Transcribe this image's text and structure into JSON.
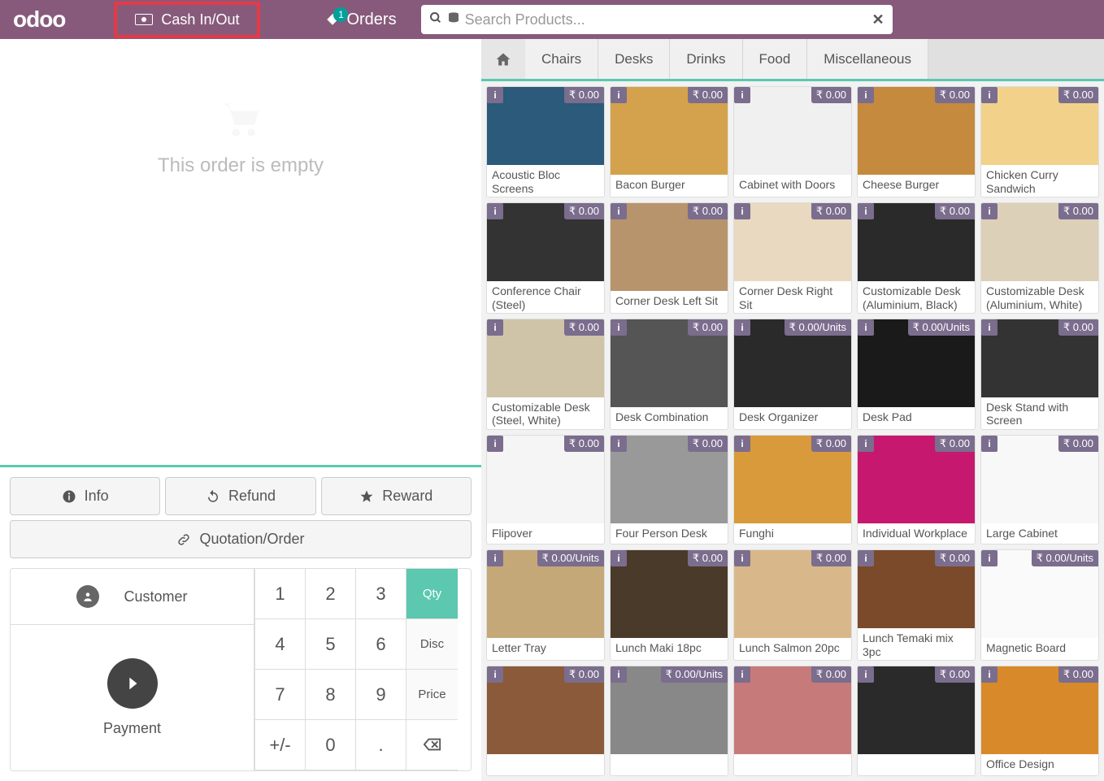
{
  "topbar": {
    "logo": "odoo",
    "cash_label": "Cash In/Out",
    "orders_label": "Orders",
    "orders_badge": "1",
    "search_placeholder": "Search Products..."
  },
  "order": {
    "empty_text": "This order is empty"
  },
  "controls": {
    "info": "Info",
    "refund": "Refund",
    "reward": "Reward",
    "quotation": "Quotation/Order"
  },
  "keypad": {
    "customer": "Customer",
    "payment": "Payment",
    "qty": "Qty",
    "disc": "Disc",
    "price": "Price",
    "keys": [
      "1",
      "2",
      "3",
      "4",
      "5",
      "6",
      "7",
      "8",
      "9",
      "+/-",
      "0",
      "."
    ]
  },
  "categories": [
    "Chairs",
    "Desks",
    "Drinks",
    "Food",
    "Miscellaneous"
  ],
  "products": [
    {
      "name": "Acoustic Bloc Screens",
      "price": "₹ 0.00",
      "bg": "#2b5a7a"
    },
    {
      "name": "Bacon Burger",
      "price": "₹ 0.00",
      "bg": "#d4a24c"
    },
    {
      "name": "Cabinet with Doors",
      "price": "₹ 0.00",
      "bg": "#f0f0f0"
    },
    {
      "name": "Cheese Burger",
      "price": "₹ 0.00",
      "bg": "#c58a3d"
    },
    {
      "name": "Chicken Curry Sandwich",
      "price": "₹ 0.00",
      "bg": "#f2d28a"
    },
    {
      "name": "Conference Chair (Steel)",
      "price": "₹ 0.00",
      "bg": "#333"
    },
    {
      "name": "Corner Desk Left Sit",
      "price": "₹ 0.00",
      "bg": "#b8946c"
    },
    {
      "name": "Corner Desk Right Sit",
      "price": "₹ 0.00",
      "bg": "#e8d9c0"
    },
    {
      "name": "Customizable Desk (Aluminium, Black)",
      "price": "₹ 0.00",
      "bg": "#2a2a2a"
    },
    {
      "name": "Customizable Desk (Aluminium, White)",
      "price": "₹ 0.00",
      "bg": "#ddd0b8"
    },
    {
      "name": "Customizable Desk (Steel, White)",
      "price": "₹ 0.00",
      "bg": "#d0c4a8"
    },
    {
      "name": "Desk Combination",
      "price": "₹ 0.00",
      "bg": "#555"
    },
    {
      "name": "Desk Organizer",
      "price": "₹ 0.00/Units",
      "bg": "#2a2a2a"
    },
    {
      "name": "Desk Pad",
      "price": "₹ 0.00/Units",
      "bg": "#1a1a1a"
    },
    {
      "name": "Desk Stand with Screen",
      "price": "₹ 0.00",
      "bg": "#333"
    },
    {
      "name": "Flipover",
      "price": "₹ 0.00",
      "bg": "#f5f5f5"
    },
    {
      "name": "Four Person Desk",
      "price": "₹ 0.00",
      "bg": "#999"
    },
    {
      "name": "Funghi",
      "price": "₹ 0.00",
      "bg": "#d89a3a"
    },
    {
      "name": "Individual Workplace",
      "price": "₹ 0.00",
      "bg": "#c6186e"
    },
    {
      "name": "Large Cabinet",
      "price": "₹ 0.00",
      "bg": "#f8f8f8"
    },
    {
      "name": "Letter Tray",
      "price": "₹ 0.00/Units",
      "bg": "#c4a878"
    },
    {
      "name": "Lunch Maki 18pc",
      "price": "₹ 0.00",
      "bg": "#4a3a2a"
    },
    {
      "name": "Lunch Salmon 20pc",
      "price": "₹ 0.00",
      "bg": "#d8b88a"
    },
    {
      "name": "Lunch Temaki mix 3pc",
      "price": "₹ 0.00",
      "bg": "#7a4a2a"
    },
    {
      "name": "Magnetic Board",
      "price": "₹ 0.00/Units",
      "bg": "#fafafa"
    },
    {
      "name": "",
      "price": "₹ 0.00",
      "bg": "#8a5a3a"
    },
    {
      "name": "",
      "price": "₹ 0.00/Units",
      "bg": "#888"
    },
    {
      "name": "",
      "price": "₹ 0.00",
      "bg": "#c77a7a"
    },
    {
      "name": "",
      "price": "₹ 0.00",
      "bg": "#2a2a2a"
    },
    {
      "name": "Office Design",
      "price": "₹ 0.00",
      "bg": "#d88a2a"
    }
  ]
}
